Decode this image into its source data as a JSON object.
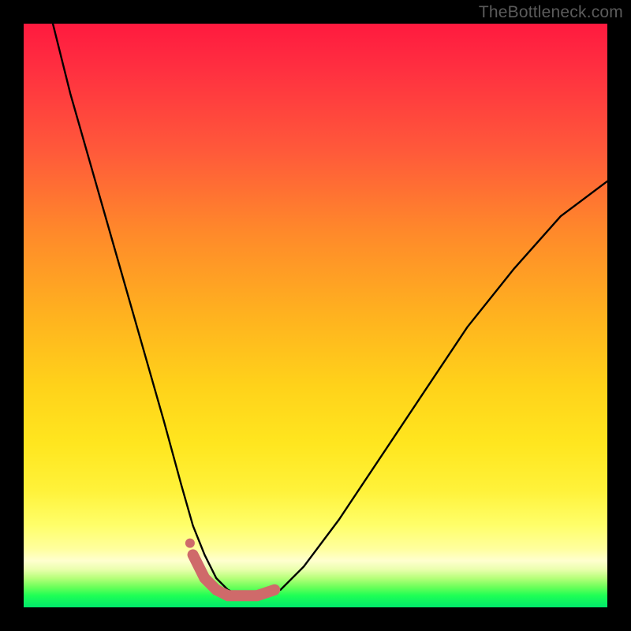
{
  "watermark": "TheBottleneck.com",
  "chart_data": {
    "type": "line",
    "title": "",
    "xlabel": "",
    "ylabel": "",
    "xlim": [
      0,
      100
    ],
    "ylim": [
      0,
      100
    ],
    "grid": false,
    "legend": false,
    "series": [
      {
        "name": "main-curve",
        "color": "#000000",
        "x": [
          5,
          8,
          12,
          16,
          20,
          24,
          27,
          29,
          31,
          33,
          35,
          37,
          40,
          44,
          48,
          54,
          60,
          68,
          76,
          84,
          92,
          100
        ],
        "y": [
          100,
          88,
          74,
          60,
          46,
          32,
          21,
          14,
          9,
          5,
          3,
          2,
          2,
          3,
          7,
          15,
          24,
          36,
          48,
          58,
          67,
          73
        ]
      },
      {
        "name": "highlight-segment",
        "color": "#cf6a6a",
        "x": [
          29,
          31,
          33,
          35,
          37,
          40,
          43
        ],
        "y": [
          9,
          5,
          3,
          2,
          2,
          2,
          3
        ]
      }
    ],
    "markers": [
      {
        "name": "highlight-dot",
        "x": 28.5,
        "y": 11,
        "color": "#cf6a6a",
        "r": 6
      }
    ],
    "background": {
      "type": "vertical-gradient",
      "stops": [
        {
          "pos": 0,
          "color": "#ff1a3f"
        },
        {
          "pos": 50,
          "color": "#ffb21f"
        },
        {
          "pos": 86,
          "color": "#ffff6a"
        },
        {
          "pos": 95,
          "color": "#b6ff7a"
        },
        {
          "pos": 100,
          "color": "#00e86b"
        }
      ]
    }
  }
}
